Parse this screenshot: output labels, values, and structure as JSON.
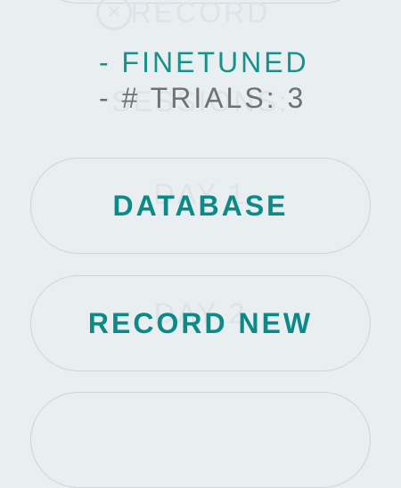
{
  "background_text": {
    "top": "RECORD",
    "sessions": "SESSIONS:",
    "day1": "DAY 1",
    "day2": "DAY 2",
    "close_icon": "close-circle-icon"
  },
  "info": {
    "line1": "- FINETUNED",
    "line2": "- # TRIALS: 3"
  },
  "buttons": {
    "database": "DATABASE",
    "record_new": "RECORD NEW"
  },
  "colors": {
    "background": "#e9eef1",
    "accent": "#0b8a87",
    "muted_text": "#6f7274",
    "border": "#cdd5d9"
  }
}
